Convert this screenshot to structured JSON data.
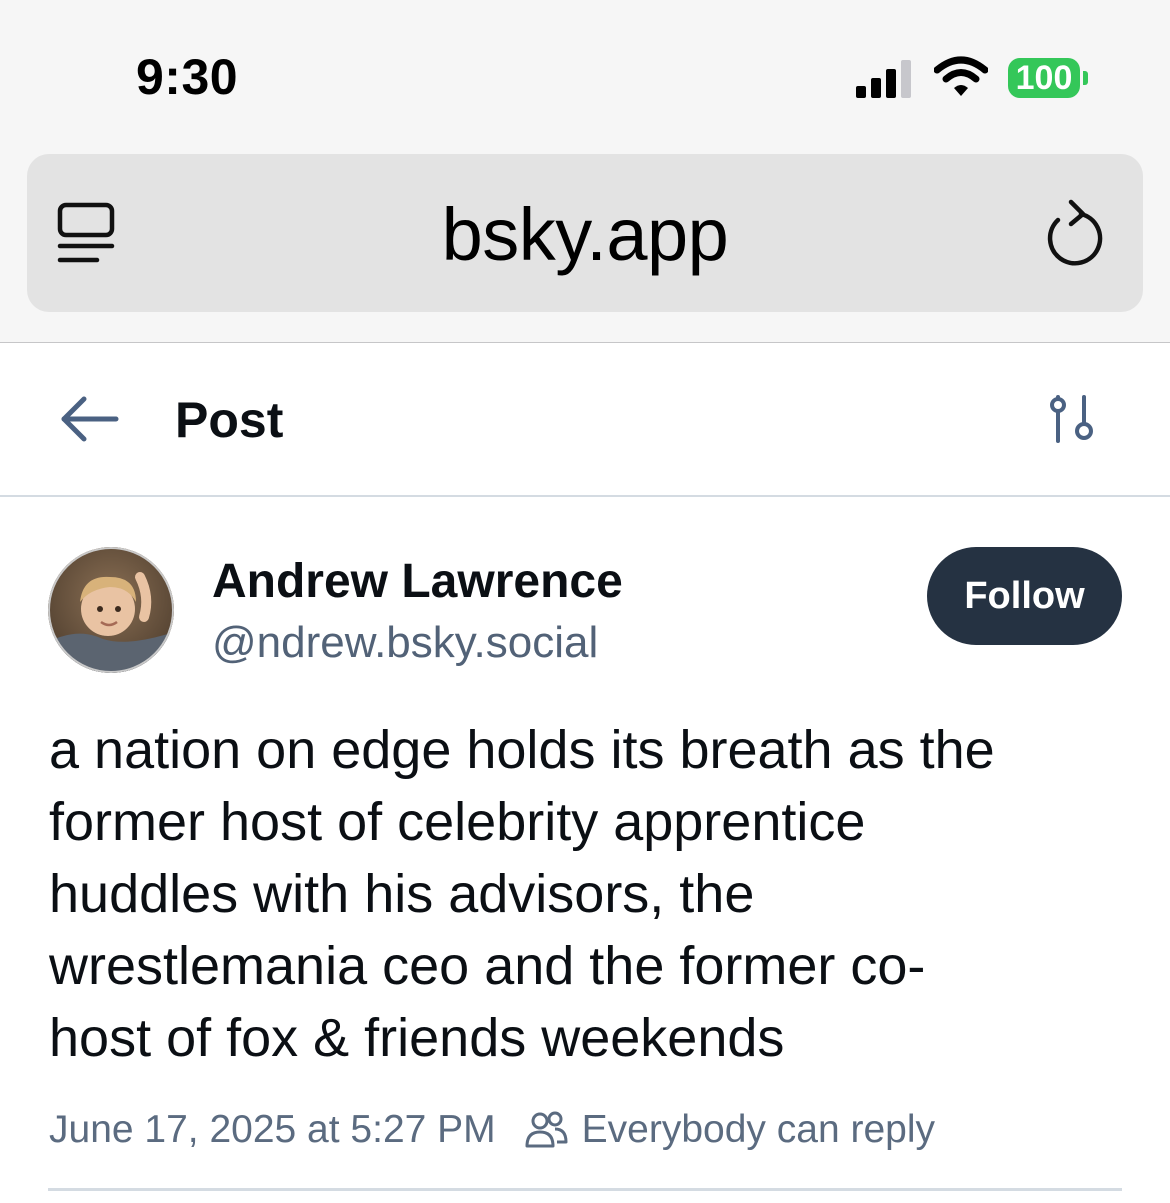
{
  "status_bar": {
    "time": "9:30",
    "battery": "100",
    "icons": [
      "cellular-signal-icon",
      "wifi-icon",
      "battery-icon"
    ]
  },
  "browser": {
    "url": "bsky.app",
    "icons": [
      "tabs-icon",
      "reload-icon"
    ]
  },
  "header": {
    "title": "Post",
    "icons": [
      "back-arrow-icon",
      "thread-options-icon"
    ]
  },
  "post": {
    "author_name": "Andrew Lawrence",
    "author_handle": "@ndrew.bsky.social",
    "follow_label": "Follow",
    "text_lines": [
      "a nation on edge holds its breath as the",
      "former host of celebrity apprentice",
      "huddles with his advisors, the",
      "wrestlemania ceo and the former co-",
      "host of fox & friends weekends"
    ],
    "timestamp": "June 17, 2025 at 5:27 PM",
    "reply_setting": "Everybody can reply"
  },
  "colors": {
    "follow_button_bg": "#253242",
    "secondary_text": "#526277",
    "battery_green": "#34c759"
  }
}
